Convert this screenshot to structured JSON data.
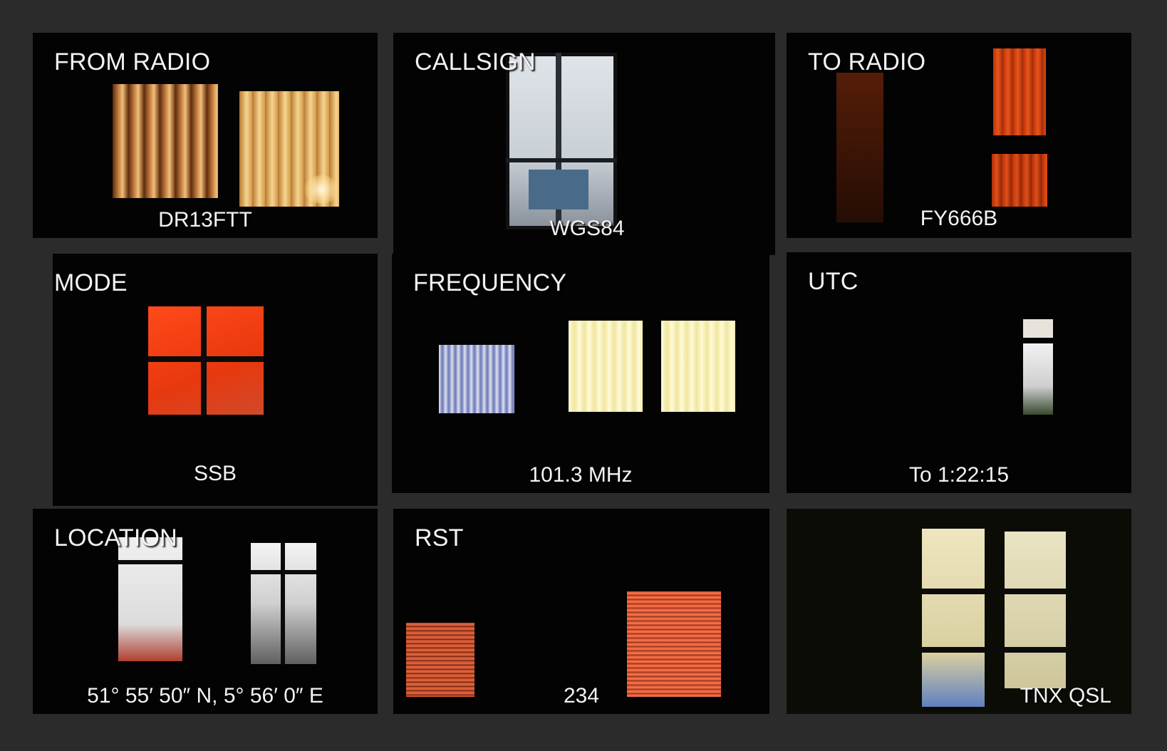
{
  "panels": [
    {
      "label": "FROM RADIO",
      "value": "DR13FTT"
    },
    {
      "label": "CALLSIGN",
      "value": "WGS84"
    },
    {
      "label": "TO RADIO",
      "value": "FY666B"
    },
    {
      "label": "MODE",
      "value": "SSB"
    },
    {
      "label": "FREQUENCY",
      "value": "101.3 MHz"
    },
    {
      "label": "UTC",
      "value": "To 1:22:15"
    },
    {
      "label": "LOCATION",
      "value": "51° 55′ 50″ N, 5° 56′ 0″ E"
    },
    {
      "label": "RST",
      "value": "234"
    },
    {
      "label": "",
      "value": "TNX QSL"
    }
  ],
  "colors": {
    "background": "#2b2b2b",
    "panel": "#030303",
    "text": "#f3f3f3"
  }
}
